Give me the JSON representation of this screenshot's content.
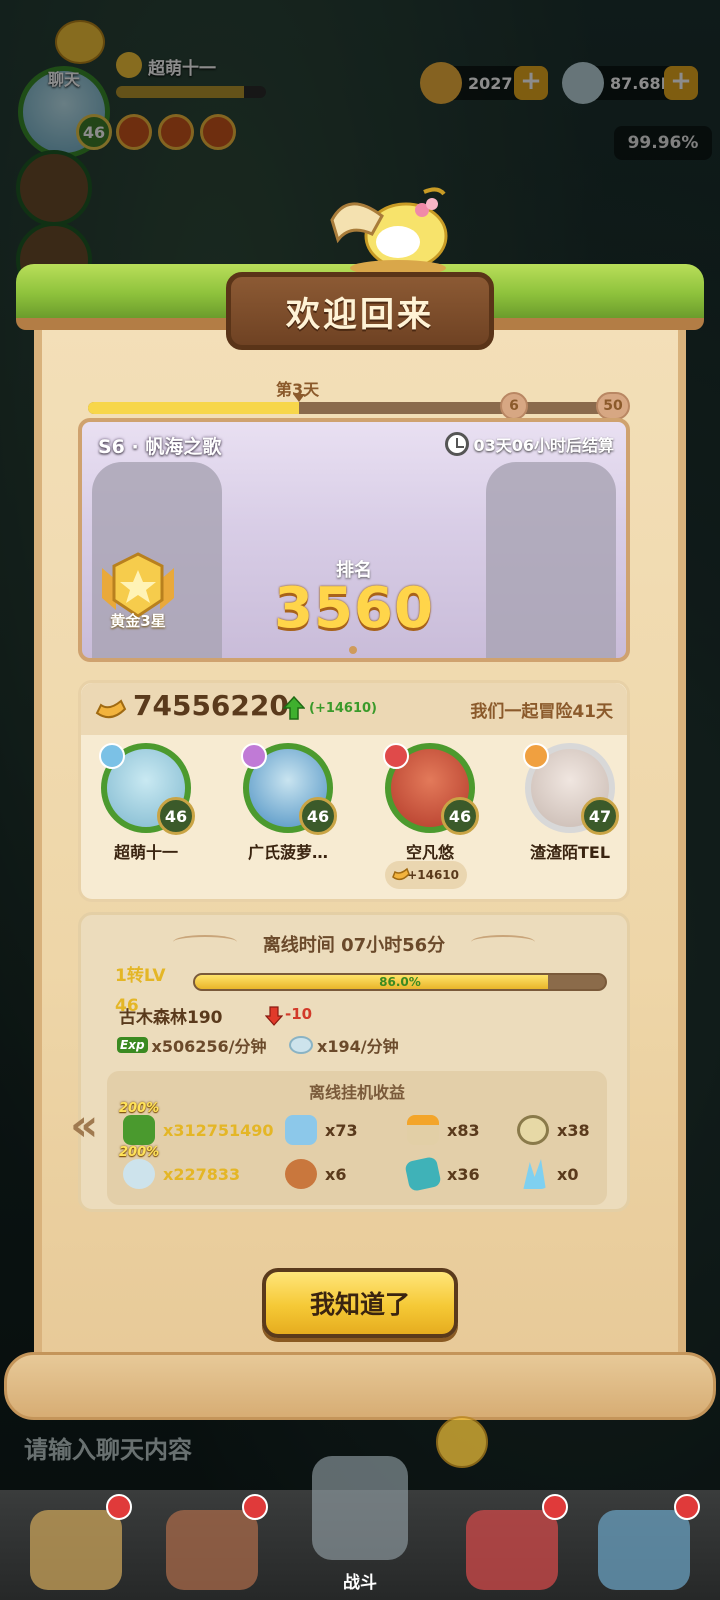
{
  "hud": {
    "chat_label": "聊天",
    "player_name": "超萌十一",
    "player_level": "46",
    "name_progress": 0.85,
    "currency_1": "2027",
    "currency_2": "87.68M",
    "plus": "+",
    "percent": "99.96%"
  },
  "dialog": {
    "title": "欢迎回来",
    "season": {
      "day_label": "第3天",
      "progress": 0.39,
      "milestones": [
        "6",
        "50"
      ],
      "name": "S6 · 帆海之歌",
      "countdown": "03天06小时后结算",
      "tier": "黄金3星",
      "rank_title": "排名",
      "rank_value": "3560"
    },
    "team": {
      "power": "74556220",
      "power_delta": "(+14610)",
      "days_together": "我们一起冒险41天",
      "members": [
        {
          "name": "超萌十一",
          "level": "46"
        },
        {
          "name": "广氏菠萝…",
          "level": "46"
        },
        {
          "name": "空凡悠",
          "level": "46"
        },
        {
          "name": "渣渣陌TEL",
          "level": "47"
        }
      ],
      "contribution": "+14610"
    },
    "offline": {
      "title": "离线时间 07小时56分",
      "lv_label": "1转LV\n46",
      "lv_progress": 0.86,
      "lv_pct": "86.0%",
      "map_name": "古木森林190",
      "map_delta": "-10",
      "exp_chip": "Exp",
      "exp_rate": "x506256/分钟",
      "stone_rate": "x194/分钟",
      "earnings_title": "离线挂机收益",
      "boost": "200%",
      "items": [
        {
          "icon": "exp-icon",
          "value": "x312751490"
        },
        {
          "icon": "ice-cube-icon",
          "value": "x73"
        },
        {
          "icon": "torch-icon",
          "value": "x83"
        },
        {
          "icon": "gear-icon",
          "value": "x38"
        },
        {
          "icon": "stone-icon",
          "value": "x227833"
        },
        {
          "icon": "meat-icon",
          "value": "x6"
        },
        {
          "icon": "crystal-icon",
          "value": "x36"
        },
        {
          "icon": "ice-shard-icon",
          "value": "x0"
        }
      ]
    },
    "confirm": "我知道了"
  },
  "bottom": {
    "chat_placeholder": "请输入聊天内容",
    "nav_active_label": "战斗"
  }
}
